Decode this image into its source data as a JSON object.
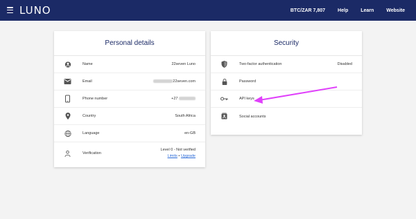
{
  "header": {
    "logo": "LUNO",
    "nav": {
      "price": "BTC/ZAR 7,807",
      "help": "Help",
      "learn": "Learn",
      "website": "Website"
    }
  },
  "personal": {
    "title": "Personal details",
    "name": {
      "label": "Name",
      "value": "22seven Luno"
    },
    "email": {
      "label": "Email",
      "value": "22seven.com"
    },
    "phone": {
      "label": "Phone number",
      "value": "+27"
    },
    "country": {
      "label": "Country",
      "value": "South Africa"
    },
    "language": {
      "label": "Language",
      "value": "en-GB"
    },
    "verification": {
      "label": "Verification",
      "value": "Level 0 - Not verified",
      "limits": "Limits",
      "separator": " • ",
      "upgrade": "Upgrade"
    }
  },
  "security": {
    "title": "Security",
    "twofa": {
      "label": "Two-factor authentication",
      "status": "Disabled"
    },
    "password": {
      "label": "Password"
    },
    "api": {
      "label": "API keys"
    },
    "social": {
      "label": "Social accounts"
    }
  },
  "colors": {
    "header": "#1b2a66",
    "accent": "#e040fb",
    "danger": "#e53935",
    "link": "#2a6ad8"
  }
}
